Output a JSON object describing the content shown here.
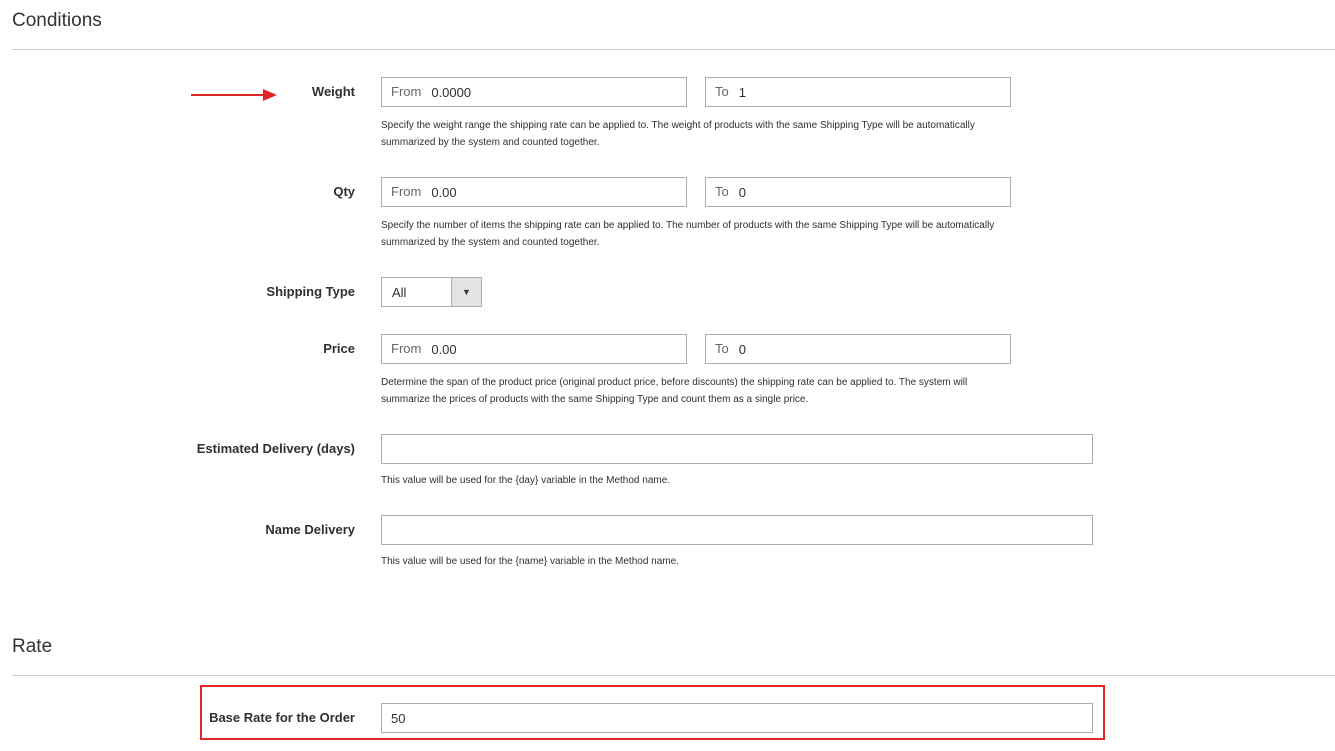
{
  "conditions": {
    "title": "Conditions",
    "weight": {
      "label": "Weight",
      "from_prefix": "From",
      "from_value": "0.0000",
      "to_prefix": "To",
      "to_value": "1",
      "note_line1": "Specify the weight range the shipping rate can be applied to. The weight of products with the same Shipping Type will be automatically",
      "note_line2": "summarized by the system and counted together."
    },
    "qty": {
      "label": "Qty",
      "from_prefix": "From",
      "from_value": "0.00",
      "to_prefix": "To",
      "to_value": "0",
      "note_line1": "Specify the number of items the shipping rate can be applied to. The number of products with the same Shipping Type will be automatically",
      "note_line2": "summarized by the system and counted together."
    },
    "shipping_type": {
      "label": "Shipping Type",
      "selected": "All"
    },
    "price": {
      "label": "Price",
      "from_prefix": "From",
      "from_value": "0.00",
      "to_prefix": "To",
      "to_value": "0",
      "note_line1": "Determine the span of the product price (original product price, before discounts) the shipping rate can be applied to. The system will",
      "note_line2": "summarize the prices of products with the same Shipping Type and count them as a single price."
    },
    "estimated_delivery": {
      "label": "Estimated Delivery (days)",
      "value": "",
      "note": "This value will be used for the {day} variable in the Method name."
    },
    "name_delivery": {
      "label": "Name Delivery",
      "value": "",
      "note": "This value will be used for the {name} variable in the Method name."
    }
  },
  "rate": {
    "title": "Rate",
    "base_rate": {
      "label": "Base Rate for the Order",
      "value": "50"
    }
  },
  "colors": {
    "annotation": "#e22626",
    "border": "#adadad",
    "rule": "#cccccc"
  }
}
